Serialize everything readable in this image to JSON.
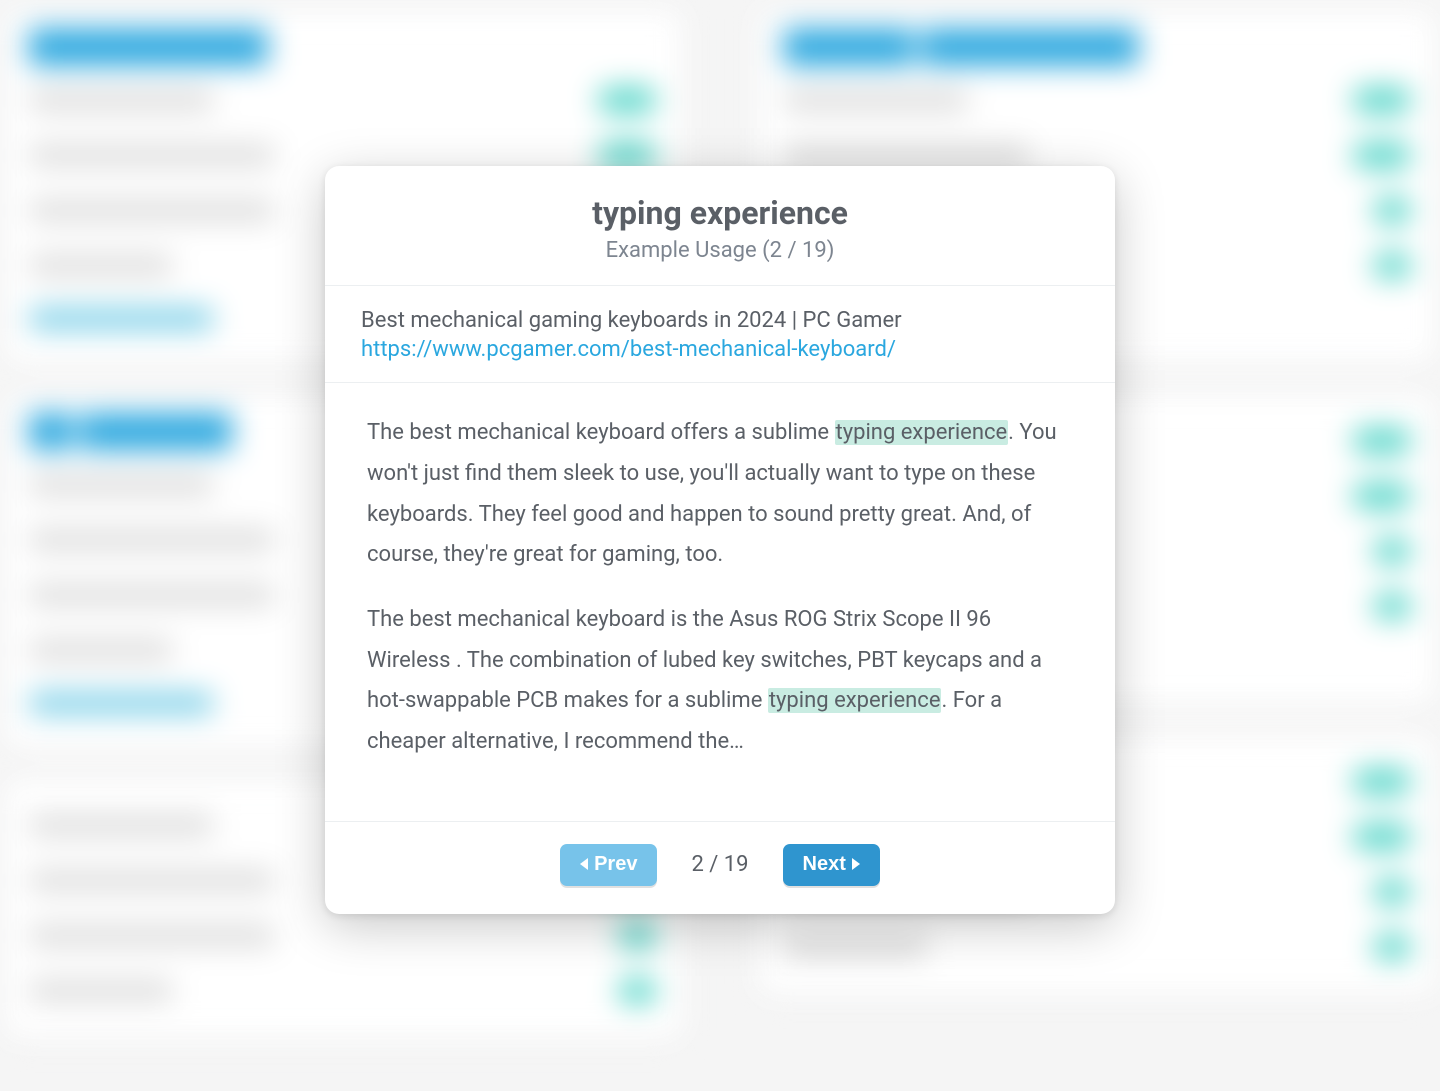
{
  "modal": {
    "title": "typing experience",
    "subtitle": "Example Usage (2 / 19)",
    "source_title": "Best mechanical gaming keyboards in 2024 | PC Gamer",
    "source_url": "https://www.pcgamer.com/best-mechanical-keyboard/",
    "highlight_term": "typing experience",
    "p1_before": "The best mechanical keyboard offers a sublime ",
    "p1_after": ". You won't just find them sleek to use, you'll actually want to type on these keyboards. They feel good and happen to sound pretty great. And, of course, they're great for gaming, too.",
    "p2_before": "The best mechanical keyboard is the Asus ROG Strix Scope II 96 Wireless . The combination of lubed key switches, PBT keycaps and a hot-swappable PCB makes for a sublime ",
    "p2_after": ". For a cheaper alternative, I recommend the…",
    "footer": {
      "prev_label": "Prev",
      "next_label": "Next",
      "page_indicator": "2 / 19"
    }
  }
}
